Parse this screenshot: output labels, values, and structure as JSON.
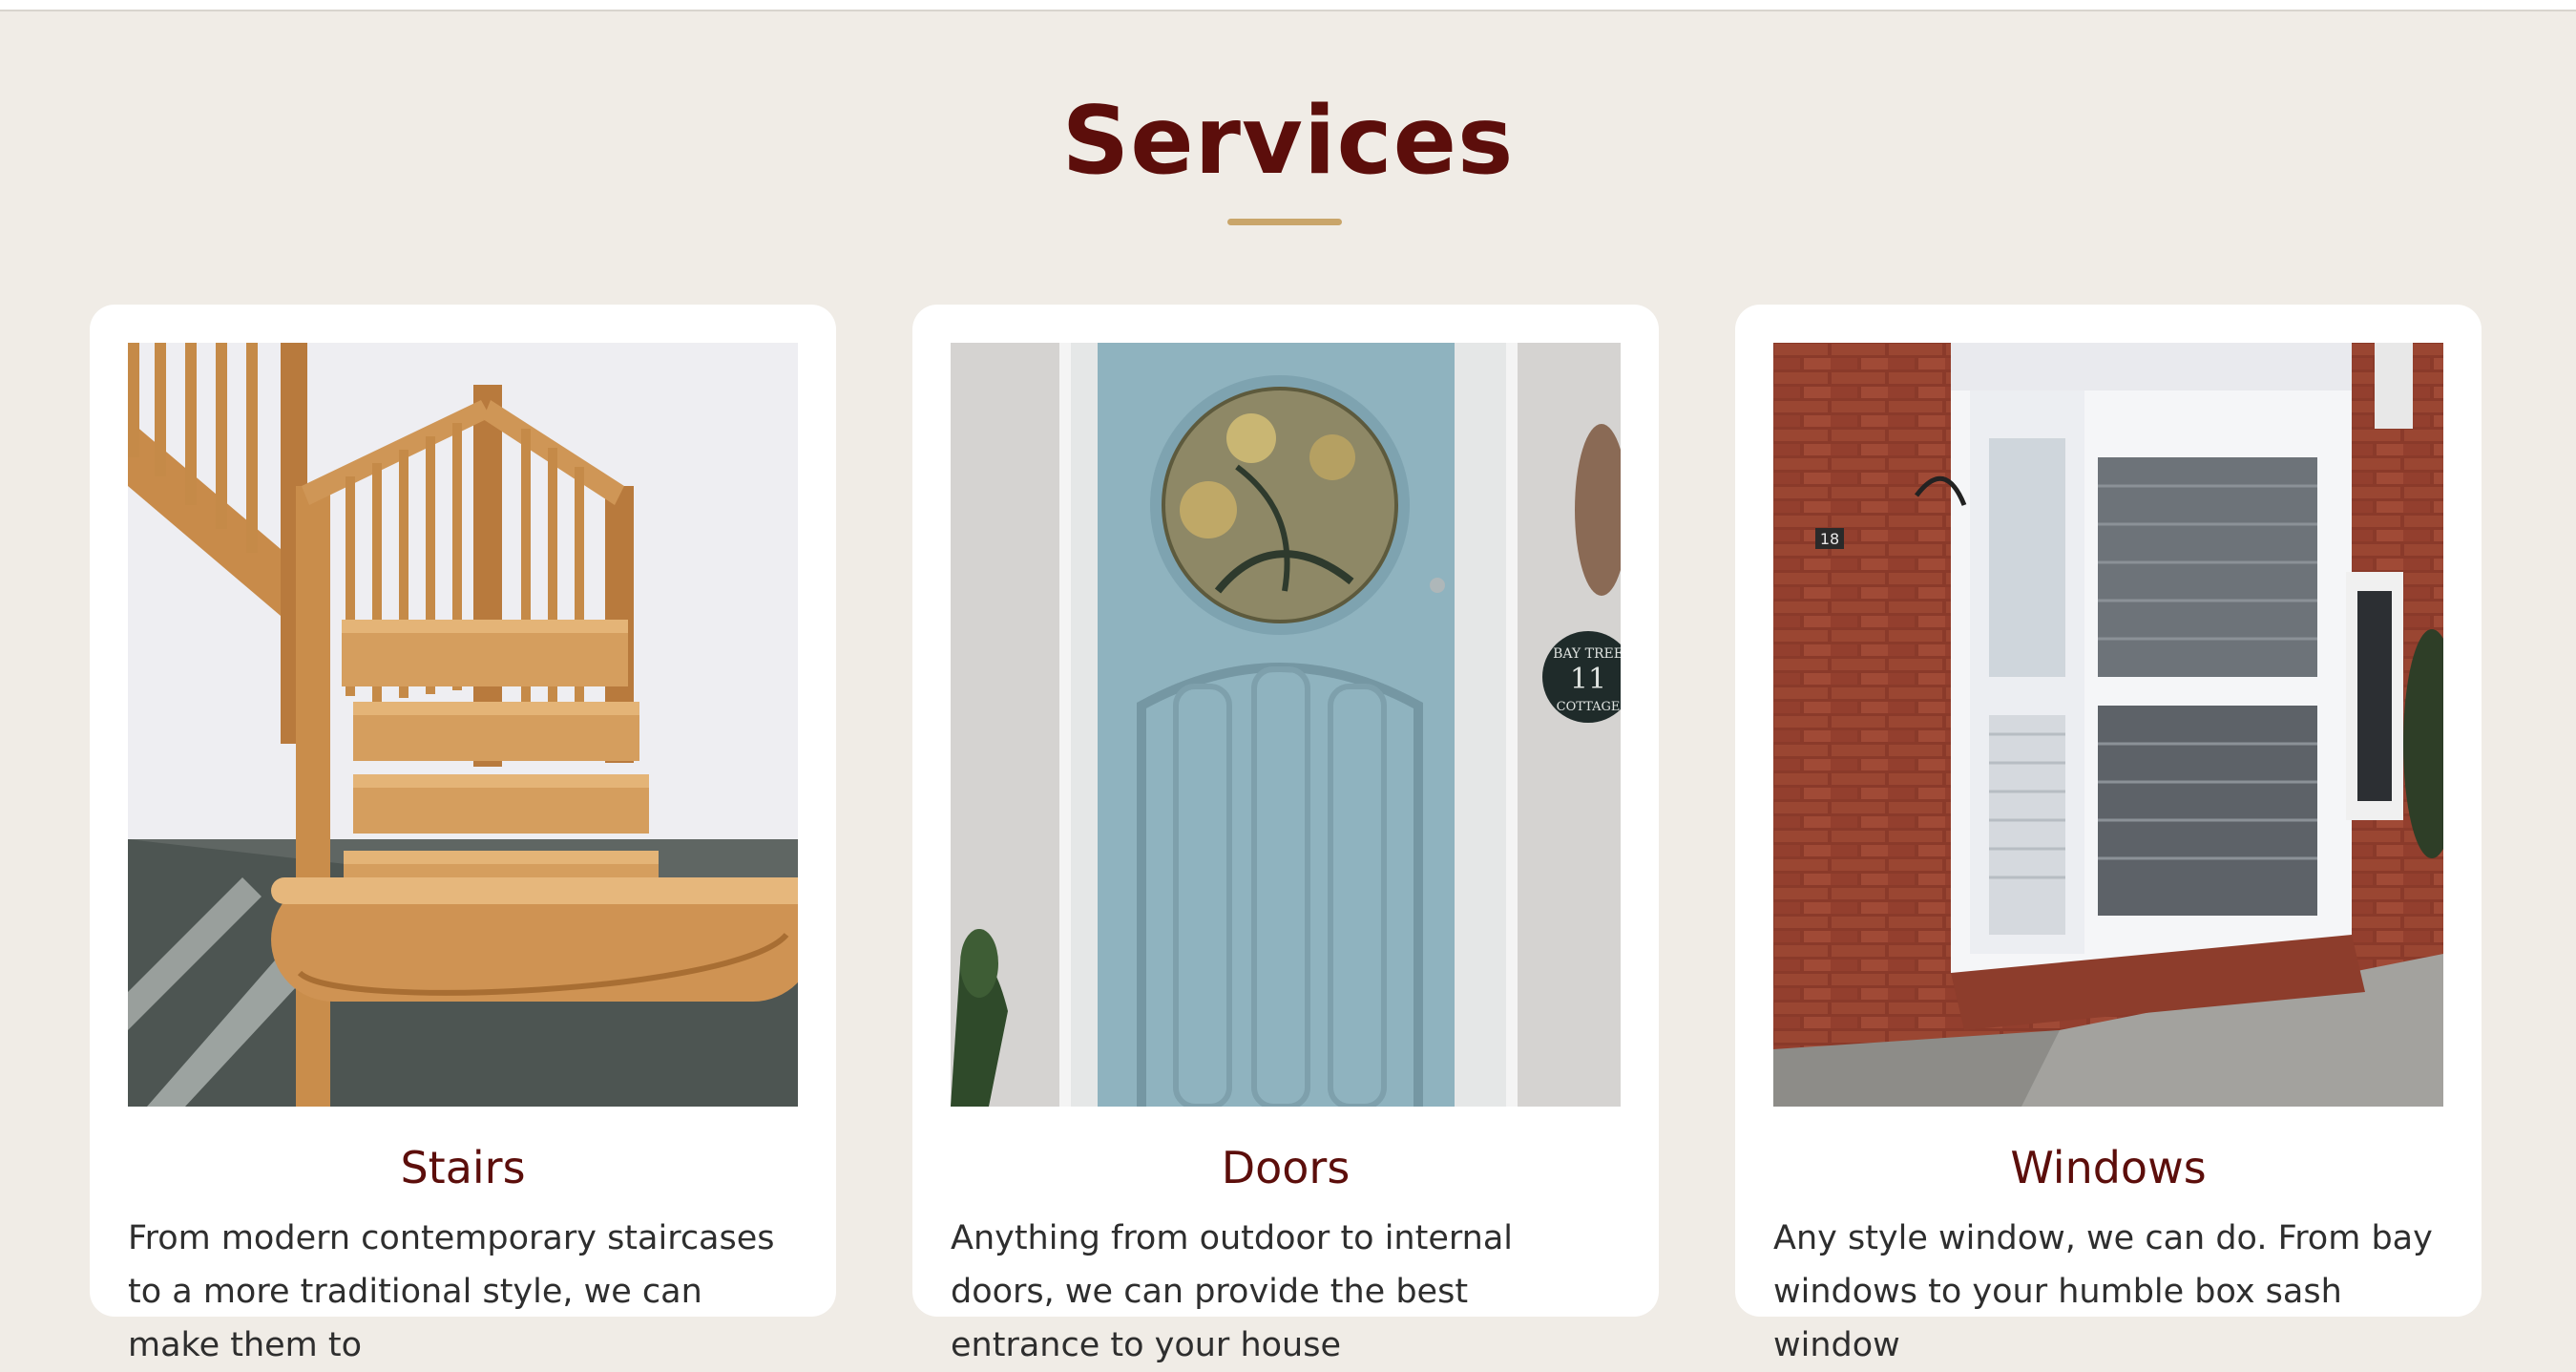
{
  "section": {
    "title": "Services"
  },
  "cards": [
    {
      "title": "Stairs",
      "text": "From modern contemporary staircases to a more traditional style, we can make them to",
      "image_alt": "Oak staircase with turned balusters"
    },
    {
      "title": "Doors",
      "text": "Anything from outdoor to internal doors, we can provide the best entrance to your house",
      "image_alt": "Pale blue front door with round stained glass window"
    },
    {
      "title": "Windows",
      "text": "Any style window, we can do. From bay windows to your humble box sash window",
      "image_alt": "White painted bay window on red brick house"
    }
  ],
  "sign": {
    "line1": "BAY TREE",
    "number": "11",
    "line2": "COTTAGE"
  },
  "house_number": "18",
  "colors": {
    "background": "#f0ece6",
    "title": "#5c0e0b",
    "accent": "#c9a56a",
    "card": "#ffffff"
  }
}
